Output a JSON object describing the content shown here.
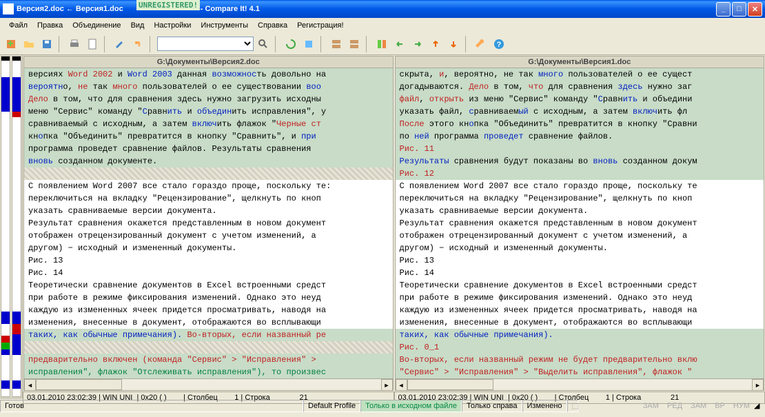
{
  "window": {
    "title_before": "Версия2.doc ← Версия1.doc",
    "unregistered": "UNREGISTERED!",
    "title_after": "- Compare It! 4.1"
  },
  "menu": [
    "Файл",
    "Правка",
    "Объединение",
    "Вид",
    "Настройки",
    "Инструменты",
    "Справка",
    "Регистрация!"
  ],
  "left": {
    "path": "G:\\Документы\\Версия2.doc",
    "lines": [
      {
        "bg": "diff",
        "spans": [
          {
            "c": "black",
            "t": "версиях "
          },
          {
            "c": "red",
            "t": "Word 2002"
          },
          {
            "c": "black",
            "t": " и "
          },
          {
            "c": "blue",
            "t": "Word 2003"
          },
          {
            "c": "black",
            "t": " данная "
          },
          {
            "c": "blue",
            "t": "возможнос"
          },
          {
            "c": "black",
            "t": "ть довольно на"
          }
        ]
      },
      {
        "bg": "diff",
        "spans": [
          {
            "c": "blue",
            "t": "вероятн"
          },
          {
            "c": "black",
            "t": "о, "
          },
          {
            "c": "red",
            "t": "не"
          },
          {
            "c": "black",
            "t": " так "
          },
          {
            "c": "red",
            "t": "много"
          },
          {
            "c": "black",
            "t": " пользователей о ее существовании "
          },
          {
            "c": "blue",
            "t": "воо"
          }
        ]
      },
      {
        "bg": "diff",
        "spans": [
          {
            "c": "red",
            "t": "Дело"
          },
          {
            "c": "black",
            "t": " в том, что для сравнения здесь нужно загрузить исходны"
          }
        ]
      },
      {
        "bg": "diff",
        "spans": [
          {
            "c": "black",
            "t": "меню \"Сервис\" команду \""
          },
          {
            "c": "blue",
            "t": "С"
          },
          {
            "c": "black",
            "t": "равн"
          },
          {
            "c": "blue",
            "t": "ить "
          },
          {
            "c": "black",
            "t": "и "
          },
          {
            "c": "blue",
            "t": "объедин"
          },
          {
            "c": "black",
            "t": "ить исправления\", у"
          }
        ]
      },
      {
        "bg": "diff",
        "spans": [
          {
            "c": "black",
            "t": "сравниваемый с исходным, а затем "
          },
          {
            "c": "blue",
            "t": "включ"
          },
          {
            "c": "black",
            "t": "ить флажок \""
          },
          {
            "c": "red",
            "t": "Черные ст"
          }
        ]
      },
      {
        "bg": "diff",
        "spans": [
          {
            "c": "black",
            "t": "кн"
          },
          {
            "c": "blue",
            "t": "о"
          },
          {
            "c": "black",
            "t": "пка \"Объединить\" превратится в кнопку \"Сравнить\", и "
          },
          {
            "c": "blue",
            "t": "при"
          }
        ]
      },
      {
        "bg": "diff",
        "spans": [
          {
            "c": "black",
            "t": "программа проведет сравнение файлов.  Результаты сравнения "
          }
        ]
      },
      {
        "bg": "diff",
        "spans": [
          {
            "c": "blue",
            "t": "вновь"
          },
          {
            "c": "black",
            "t": " созданном документе."
          }
        ]
      },
      {
        "bg": "hatch",
        "spans": []
      },
      {
        "bg": "",
        "spans": [
          {
            "c": "black",
            "t": ""
          }
        ]
      },
      {
        "bg": "",
        "spans": [
          {
            "c": "black",
            "t": "С появлением Word 2007 все стало гораздо проще, поскольку те:"
          }
        ]
      },
      {
        "bg": "",
        "spans": [
          {
            "c": "black",
            "t": "переключиться на вкладку \"Рецензирование\", щелкнуть по кноп"
          }
        ]
      },
      {
        "bg": "",
        "spans": [
          {
            "c": "black",
            "t": "указать сравниваемые версии документа."
          }
        ]
      },
      {
        "bg": "",
        "spans": [
          {
            "c": "black",
            "t": "Результат сравнения окажется представленным в новом документ"
          }
        ]
      },
      {
        "bg": "",
        "spans": [
          {
            "c": "black",
            "t": "отображен отрецензированный документ с учетом изменений, а "
          }
        ]
      },
      {
        "bg": "",
        "spans": [
          {
            "c": "black",
            "t": "другом) − исходный и измененный документы."
          }
        ]
      },
      {
        "bg": "",
        "spans": [
          {
            "c": "black",
            "t": "Рис. 13"
          }
        ]
      },
      {
        "bg": "",
        "spans": [
          {
            "c": "black",
            "t": "Рис. 14"
          }
        ]
      },
      {
        "bg": "",
        "spans": [
          {
            "c": "black",
            "t": "Теоретически сравнение документов в Excel встроенными средст"
          }
        ]
      },
      {
        "bg": "",
        "spans": [
          {
            "c": "black",
            "t": "при работе в режиме фиксирования изменений. Однако это неуд"
          }
        ]
      },
      {
        "bg": "",
        "spans": [
          {
            "c": "black",
            "t": "каждую из измененных ячеек придется просматривать, наводя на"
          }
        ]
      },
      {
        "bg": "",
        "spans": [
          {
            "c": "black",
            "t": "изменения, внесенные в документ, отображаются во всплывающи"
          }
        ]
      },
      {
        "bg": "diff",
        "spans": [
          {
            "c": "blue",
            "t": "таких, как обычные примечания)."
          },
          {
            "c": "red",
            "t": " Во-вторых, если названный ре"
          }
        ]
      },
      {
        "bg": "hatch",
        "spans": []
      },
      {
        "bg": "diff",
        "spans": [
          {
            "c": "red",
            "t": "предварительно включен (команда \"Сервис\" > \"Исправления\" > "
          }
        ]
      },
      {
        "bg": "diff",
        "spans": [
          {
            "c": "green",
            "t": "исправления\", флажок \"Отслеживать исправления\"), то произвес"
          }
        ]
      }
    ]
  },
  "right": {
    "path": "G:\\Документы\\Версия1.doc",
    "lines": [
      {
        "bg": "diff",
        "spans": [
          {
            "c": "black",
            "t": "скрыта, "
          },
          {
            "c": "red",
            "t": "и"
          },
          {
            "c": "black",
            "t": ", вероятно, не так "
          },
          {
            "c": "blue",
            "t": "много"
          },
          {
            "c": "black",
            "t": " пользователей о ее сущест"
          }
        ]
      },
      {
        "bg": "diff",
        "spans": [
          {
            "c": "black",
            "t": "догадываются. "
          },
          {
            "c": "red",
            "t": "Дело"
          },
          {
            "c": "black",
            "t": " в том, "
          },
          {
            "c": "red",
            "t": "что"
          },
          {
            "c": "black",
            "t": " для сравнения "
          },
          {
            "c": "blue",
            "t": "здесь"
          },
          {
            "c": "black",
            "t": " нужно заг"
          }
        ]
      },
      {
        "bg": "diff",
        "spans": [
          {
            "c": "red",
            "t": "файл"
          },
          {
            "c": "black",
            "t": ", "
          },
          {
            "c": "red",
            "t": "открыть"
          },
          {
            "c": "black",
            "t": " из меню \"Сервис\" команду \""
          },
          {
            "c": "blue",
            "t": "С"
          },
          {
            "c": "black",
            "t": "равн"
          },
          {
            "c": "blue",
            "t": "ить"
          },
          {
            "c": "black",
            "t": " и объедини"
          }
        ]
      },
      {
        "bg": "diff",
        "spans": [
          {
            "c": "black",
            "t": "указать файл, "
          },
          {
            "c": "blue",
            "t": "с"
          },
          {
            "c": "black",
            "t": "равниваем"
          },
          {
            "c": "blue",
            "t": "ый"
          },
          {
            "c": "black",
            "t": " с исходным, а затем "
          },
          {
            "c": "blue",
            "t": "включ"
          },
          {
            "c": "black",
            "t": "ить фл"
          }
        ]
      },
      {
        "bg": "diff",
        "spans": [
          {
            "c": "red",
            "t": "После"
          },
          {
            "c": "black",
            "t": " этого кн"
          },
          {
            "c": "blue",
            "t": "о"
          },
          {
            "c": "black",
            "t": "пка \"Объединить\" превратится в кнопку \"Сравни"
          }
        ]
      },
      {
        "bg": "diff",
        "spans": [
          {
            "c": "black",
            "t": "по "
          },
          {
            "c": "blue",
            "t": "ней"
          },
          {
            "c": "black",
            "t": " программа "
          },
          {
            "c": "blue",
            "t": "проведет"
          },
          {
            "c": "black",
            "t": " сравнение файлов."
          }
        ]
      },
      {
        "bg": "diff",
        "spans": [
          {
            "c": "red",
            "t": "Рис. 11"
          }
        ]
      },
      {
        "bg": "diff",
        "spans": [
          {
            "c": "blue",
            "t": "Результаты"
          },
          {
            "c": "black",
            "t": " сравнения будут показаны во "
          },
          {
            "c": "blue",
            "t": "вновь"
          },
          {
            "c": "black",
            "t": " созданном докум"
          }
        ]
      },
      {
        "bg": "diff",
        "spans": [
          {
            "c": "red",
            "t": "Рис. 12"
          }
        ]
      },
      {
        "bg": "",
        "spans": [
          {
            "c": "black",
            "t": ""
          }
        ]
      },
      {
        "bg": "",
        "spans": [
          {
            "c": "black",
            "t": "С появлением Word 2007 все стало гораздо проще, поскольку те"
          }
        ]
      },
      {
        "bg": "",
        "spans": [
          {
            "c": "black",
            "t": "переключиться на вкладку \"Рецензирование\", щелкнуть по кноп"
          }
        ]
      },
      {
        "bg": "",
        "spans": [
          {
            "c": "black",
            "t": "указать сравниваемые версии документа."
          }
        ]
      },
      {
        "bg": "",
        "spans": [
          {
            "c": "black",
            "t": "Результат сравнения окажется представленным в новом документ"
          }
        ]
      },
      {
        "bg": "",
        "spans": [
          {
            "c": "black",
            "t": "отображен отрецензированный документ с учетом изменений, а "
          }
        ]
      },
      {
        "bg": "",
        "spans": [
          {
            "c": "black",
            "t": "другом) − исходный и измененный документы."
          }
        ]
      },
      {
        "bg": "",
        "spans": [
          {
            "c": "black",
            "t": "Рис. 13"
          }
        ]
      },
      {
        "bg": "",
        "spans": [
          {
            "c": "black",
            "t": "Рис. 14"
          }
        ]
      },
      {
        "bg": "",
        "spans": [
          {
            "c": "black",
            "t": "Теоретически сравнение документов в Excel встроенными средст"
          }
        ]
      },
      {
        "bg": "",
        "spans": [
          {
            "c": "black",
            "t": "при работе в режиме фиксирования изменений. Однако это неуд"
          }
        ]
      },
      {
        "bg": "",
        "spans": [
          {
            "c": "black",
            "t": "каждую из измененных ячеек придется просматривать, наводя на"
          }
        ]
      },
      {
        "bg": "",
        "spans": [
          {
            "c": "black",
            "t": "изменения, внесенные в документ, отображаются во всплывающи"
          }
        ]
      },
      {
        "bg": "diff",
        "spans": [
          {
            "c": "blue",
            "t": "таких, как обычные примечания)."
          }
        ]
      },
      {
        "bg": "diff",
        "spans": [
          {
            "c": "red",
            "t": "Рис. 0_1"
          }
        ]
      },
      {
        "bg": "diff",
        "spans": [
          {
            "c": "red",
            "t": "Во-вторых, если названный режим не будет предварительно вклю"
          }
        ]
      },
      {
        "bg": "diff",
        "spans": [
          {
            "c": "red",
            "t": "\"Сервис\" > \"Исправления\" > \"Выделить исправления\", флажок \""
          }
        ]
      }
    ]
  },
  "info": {
    "date": "03.01.2010",
    "time": "23:02:39",
    "enc": "WIN UNI",
    "hex": "0x20 ( )",
    "col_label": "Столбец",
    "col": "1",
    "row_label": "Строка",
    "row": "21"
  },
  "status": {
    "ready": "Готов",
    "profile": "Default Profile",
    "only_left": "Только в исходном файле",
    "only_right": "Только справа",
    "changed": "Изменено",
    "ind": [
      "ЗАМ",
      "РЕД",
      "ЗАМ",
      "ВР",
      "НУМ"
    ]
  },
  "colors": {
    "diff_bg": "#c8dcc8"
  }
}
